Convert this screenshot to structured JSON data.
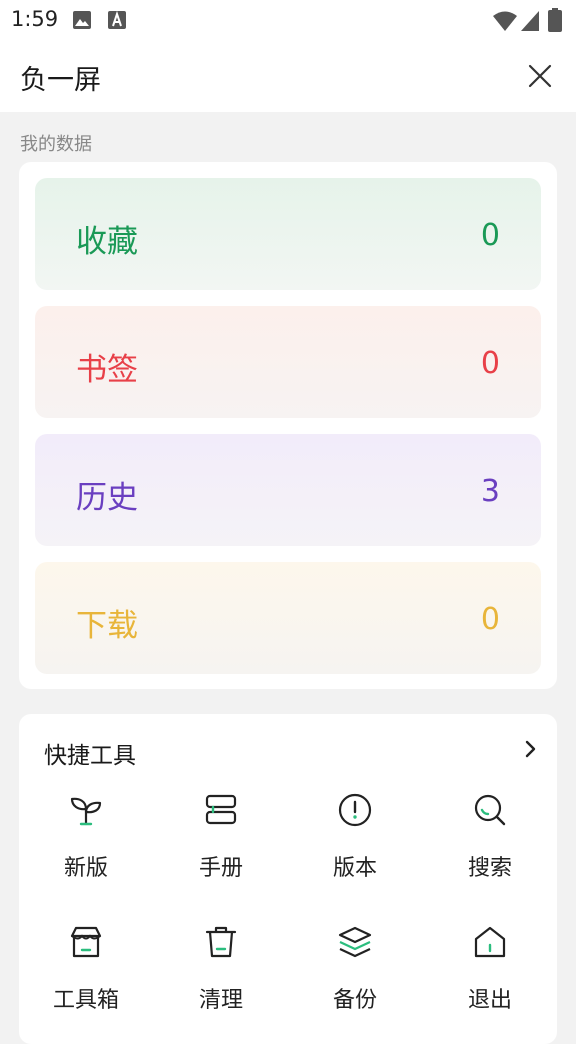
{
  "status": {
    "time": "1:59"
  },
  "header": {
    "title": "负一屏"
  },
  "my_data": {
    "label": "我的数据",
    "rows": [
      {
        "label": "收藏",
        "count": "0",
        "color": "#1a9956"
      },
      {
        "label": "书签",
        "count": "0",
        "color": "#e84048"
      },
      {
        "label": "历史",
        "count": "3",
        "color": "#6a3fc0"
      },
      {
        "label": "下载",
        "count": "0",
        "color": "#e8b53a"
      }
    ]
  },
  "tools": {
    "title": "快捷工具",
    "items": [
      {
        "label": "新版",
        "icon": "sprout-icon"
      },
      {
        "label": "手册",
        "icon": "book-icon"
      },
      {
        "label": "版本",
        "icon": "info-circle-icon"
      },
      {
        "label": "搜索",
        "icon": "search-icon"
      },
      {
        "label": "工具箱",
        "icon": "toolbox-icon"
      },
      {
        "label": "清理",
        "icon": "trash-icon"
      },
      {
        "label": "备份",
        "icon": "layers-icon"
      },
      {
        "label": "退出",
        "icon": "home-icon"
      }
    ]
  }
}
